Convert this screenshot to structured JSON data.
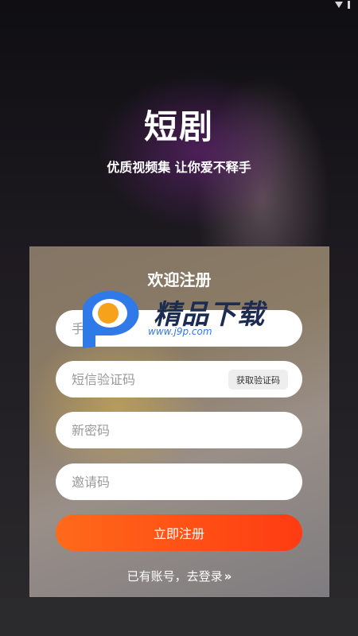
{
  "status_bar": {
    "time": "",
    "icons": [
      "wifi-icon",
      "battery-icon"
    ]
  },
  "app": {
    "title": "短剧",
    "tagline": "优质视频集 让你爱不释手"
  },
  "register": {
    "title": "欢迎注册",
    "phone_placeholder": "手机号",
    "sms_placeholder": "短信验证码",
    "get_code_label": "获取验证码",
    "new_password_placeholder": "新密码",
    "invite_code_placeholder": "邀请码",
    "submit_label": "立即注册",
    "login_prompt": "已有账号，去登录",
    "login_arrows": "»"
  },
  "watermark": {
    "brand": "精品下载",
    "url": "www.j9p.com"
  },
  "colors": {
    "accent_start": "#ff6a1a",
    "accent_end": "#ff3b12",
    "watermark_blue": "#2f7ae8",
    "watermark_orange": "#f7a21b"
  }
}
